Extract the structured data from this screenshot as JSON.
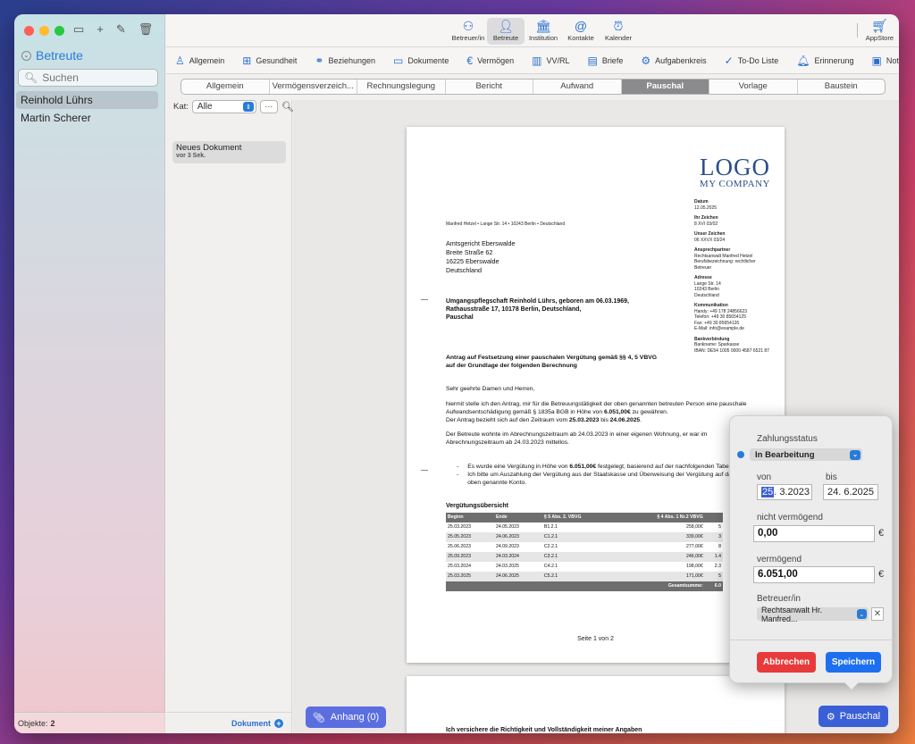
{
  "sidebar": {
    "title": "Betreute",
    "search_placeholder": "Suchen",
    "people": [
      "Reinhold Lührs",
      "Martin Scherer"
    ],
    "footer_label": "Objekte:",
    "footer_count": "2"
  },
  "toolbar": {
    "items": [
      {
        "label": "Betreuer/in",
        "icon": "people-icon"
      },
      {
        "label": "Betreute",
        "icon": "person-icon"
      },
      {
        "label": "Institution",
        "icon": "building-icon"
      },
      {
        "label": "Kontakte",
        "icon": "at-icon"
      },
      {
        "label": "Kalender",
        "icon": "alarm-icon"
      }
    ],
    "appstore_label": "AppStore"
  },
  "nav2": {
    "items": [
      "Allgemein",
      "Gesundheit",
      "Beziehungen",
      "Dokumente",
      "Vermögen",
      "VV/RL",
      "Briefe",
      "Aufgabenkreis",
      "To-Do Liste",
      "Erinnerung",
      "Notiz"
    ]
  },
  "segments": [
    "Allgemein",
    "Vermögensverzeich...",
    "Rechnungslegung",
    "Bericht",
    "Aufwand",
    "Pauschal",
    "Vorlage",
    "Baustein"
  ],
  "doclist": {
    "kat_label": "Kat:",
    "kat_value": "Alle",
    "more_label": "···",
    "item_title": "Neues Dokument",
    "item_date": "vor 3 Sek.",
    "footer_label": "Dokument"
  },
  "letter": {
    "logo_line1": "LOGO",
    "logo_line2": "MY COMPANY",
    "sender_line": "Manfred Hetzel • Lange Str. 14 • 10243 Berlin • Deutschland",
    "recipient": [
      "Amtsgericht Eberswalde",
      "Breite Straße 62",
      "16225 Eberswalde",
      "Deutschland"
    ],
    "info": [
      {
        "h": "Datum",
        "v": [
          "12.05.2025"
        ]
      },
      {
        "h": "Ihr Zeichen",
        "v": [
          "8 XVI 03/02"
        ]
      },
      {
        "h": "Unser Zeichen",
        "v": [
          "06 XXVX 03/24"
        ]
      },
      {
        "h": "Ansprechpartner",
        "v": [
          "Rechtsanwalt Manfred Hetzel",
          "Berufsbezeichnung: rechtlicher",
          "Betreuer"
        ]
      },
      {
        "h": "Adresse",
        "v": [
          "Lange Str. 14",
          "10243 Berlin",
          "Deutschland"
        ]
      },
      {
        "h": "Kommunikation",
        "v": [
          "Handy: +49 178 24856623",
          "Telefon: +49 30 85654125",
          "Fax: +49 30 85654126",
          "E-Mail: info@example.de"
        ]
      },
      {
        "h": "Bankverbindung",
        "v": [
          "Bankname: Sparkasse",
          "IBAN: DE54 1005 0000 4587 6521 87"
        ]
      }
    ],
    "subject": [
      "Umgangspflegschaft Reinhold Lührs, geboren am 06.03.1969,",
      "Rathausstraße 17, 10178 Berlin, Deutschland,",
      "Pauschal"
    ],
    "antrag": [
      "Antrag auf Festsetzung einer pauschalen Vergütung gemäß §§ 4, 5 VBVG",
      "auf der Grundlage der folgenden Berechnung"
    ],
    "greeting": "Sehr geehrte Damen und Herren,",
    "para1_a": "hiermit stelle ich den Antrag, mir für die Betreuungstätigkeit der oben genannten betreuten Person eine pauschale Aufwandsentschädigung gemäß § 1835a BGB in Höhe von ",
    "para1_amount": "6.051,00€",
    "para1_b": " zu gewähren.",
    "para2_a": "Der Antrag bezieht sich auf den Zeitraum vom ",
    "para2_from": "25.03.2023",
    "para2_mid": " bis ",
    "para2_to": "24.06.2025",
    "para2_end": ".",
    "para3": "Der Betreute wohnte im Abrechnungszeitraum ab 24.03.2023 in einer eigenen Wohnung, er war im Abrechnungszeitraum ab 24.03.2023 mittellos.",
    "bullet1_a": "Es wurde eine Vergütung in Höhe von ",
    "bullet1_amount": "6.051,00€",
    "bullet1_b": " festgelegt, basierend auf der nachfolgenden Tabelle.",
    "bullet2": "Ich bitte um Auszahlung der Vergütung aus der Staatskasse und Überweisung der Vergütung auf das oben genannte Konto.",
    "table_title": "Vergütungsübersicht",
    "table_headers": [
      "Beginn",
      "Ende",
      "§ 5 Abs. 2. VBVG",
      "§ 4 Abs. 1 Nr.2 VBVG",
      ""
    ],
    "table_rows": [
      [
        "25.03.2023",
        "24.05.2023",
        "B1.2.1",
        "258,00€",
        "5"
      ],
      [
        "25.05.2023",
        "24.06.2023",
        "C1.2.1",
        "339,00€",
        "3"
      ],
      [
        "25.06.2023",
        "24.09.2023",
        "C2.2.1",
        "277,00€",
        "8"
      ],
      [
        "25.09.2023",
        "24.03.2024",
        "C3.2.1",
        "246,00€",
        "1.4"
      ],
      [
        "25.03.2024",
        "24.03.2025",
        "C4.2.1",
        "198,00€",
        "2.3"
      ],
      [
        "25.03.2025",
        "24.06.2025",
        "C5.2.1",
        "171,00€",
        "5"
      ]
    ],
    "table_sum_label": "Gesamtsumme:",
    "table_sum_value": "6.0",
    "page_number": "Seite 1 von 2",
    "page2_text": "Ich versichere die Richtigkeit und Vollständigkeit meiner Angaben"
  },
  "buttons": {
    "anhang": "Anhang (0)",
    "pauschal": "Pauschal"
  },
  "popover": {
    "status_label": "Zahlungsstatus",
    "status_value": "In Bearbeitung",
    "von_label": "von",
    "bis_label": "bis",
    "von_day": "25",
    "von_rest": ". 3.2023",
    "bis_value": "24.  6.2025",
    "nicht_label": "nicht vermögend",
    "nicht_value": "0,00",
    "verm_label": "vermögend",
    "verm_value": "6.051,00",
    "currency": "€",
    "betreuer_label": "Betreuer/in",
    "betreuer_value": "Rechtsanwalt Hr. Manfred...",
    "cancel": "Abbrechen",
    "save": "Speichern"
  },
  "colors": {
    "accent": "#2a7bd8",
    "cancel": "#e83a3a",
    "save": "#1e6ff0"
  }
}
